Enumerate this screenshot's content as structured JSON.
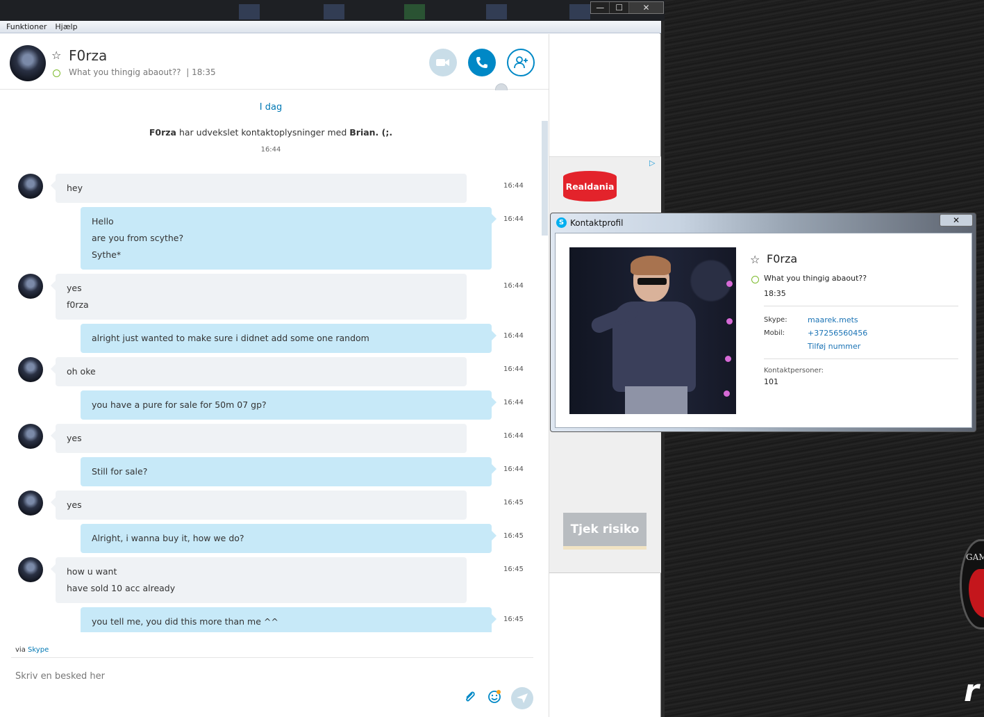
{
  "menu": {
    "items": [
      "Funktioner",
      "Hjælp"
    ]
  },
  "window": {
    "min": "—",
    "max": "☐",
    "close": "✕"
  },
  "header": {
    "name": "F0rza",
    "mood": "What you thingig abaout??",
    "separator": "|",
    "time": "18:35"
  },
  "chat": {
    "day_label": "I dag",
    "system": {
      "name": "F0rza",
      "text": " har udvekslet kontaktoplysninger med ",
      "target": "Brian. (;.",
      "time": "16:44"
    },
    "messages": [
      {
        "dir": "in",
        "lines": [
          "hey"
        ],
        "time": "16:44"
      },
      {
        "dir": "out",
        "lines": [
          "Hello",
          "are you from scythe?",
          "Sythe*"
        ],
        "time": "16:44"
      },
      {
        "dir": "in",
        "lines": [
          "yes",
          "f0rza"
        ],
        "time": "16:44"
      },
      {
        "dir": "out",
        "lines": [
          "alright just wanted to make sure i didnet add some one random"
        ],
        "time": "16:44"
      },
      {
        "dir": "in",
        "lines": [
          "oh oke"
        ],
        "time": "16:44"
      },
      {
        "dir": "out",
        "lines": [
          "you have a pure for sale for 50m 07 gp?"
        ],
        "time": "16:44"
      },
      {
        "dir": "in",
        "lines": [
          "yes"
        ],
        "time": "16:44"
      },
      {
        "dir": "out",
        "lines": [
          "Still for sale?"
        ],
        "time": "16:44"
      },
      {
        "dir": "in",
        "lines": [
          "yes"
        ],
        "time": "16:45"
      },
      {
        "dir": "out",
        "lines": [
          "Alright, i wanna buy it, how we do?"
        ],
        "time": "16:45"
      },
      {
        "dir": "in",
        "lines": [
          "how u want",
          "have sold 10 acc already"
        ],
        "time": "16:45"
      },
      {
        "dir": "out",
        "lines": [
          "you tell me, you did this more than me ^^"
        ],
        "time": "16:45"
      }
    ]
  },
  "composer": {
    "via_prefix": "via ",
    "via_link": "Skype",
    "placeholder": "Skriv en besked her"
  },
  "ad": {
    "choice": "▷",
    "brand": "Realdania",
    "cta": "Tjek risiko"
  },
  "profile": {
    "window_title": "Kontaktprofil",
    "close": "✕",
    "name": "F0rza",
    "mood": "What you thingig abaout??",
    "time": "18:35",
    "skype_label": "Skype:",
    "skype_value": "maarek.mets",
    "mobile_label": "Mobil:",
    "mobile_value": "+37256560456",
    "add_number": "Tilføj nummer",
    "contacts_label": "Kontaktpersoner:",
    "contacts_value": "101"
  },
  "desktop": {
    "logo_text": "GAM",
    "mark": "r"
  },
  "colors": {
    "accent": "#0088c6",
    "incoming": "#eff2f5",
    "outgoing": "#c7e9f8",
    "status_online": "#7dbb2d"
  }
}
